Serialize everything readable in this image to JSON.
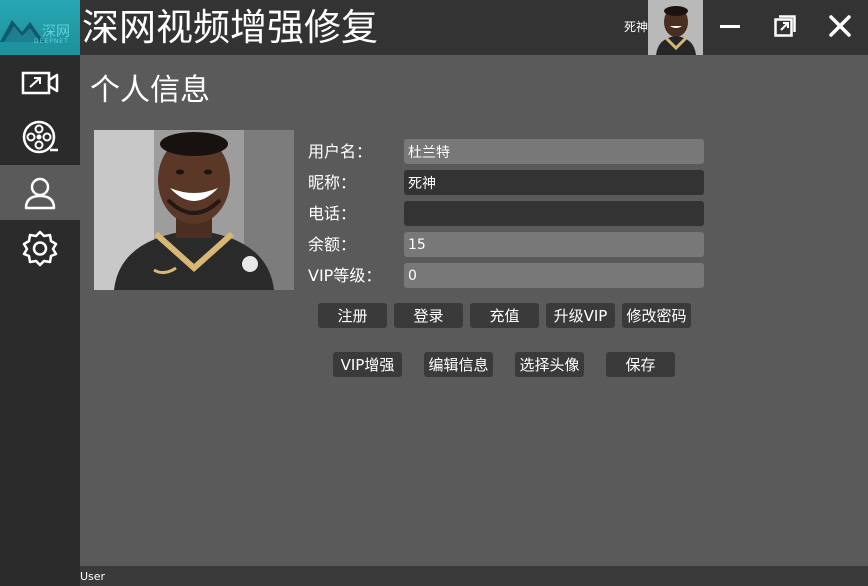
{
  "app": {
    "title": "深网视频增强修复",
    "logo_text": "DEEPNET"
  },
  "header": {
    "username": "死神",
    "avatar_icon": "user-avatar-photo",
    "controls": [
      "minimize-icon",
      "restore-icon",
      "close-icon"
    ]
  },
  "sidebar": {
    "items": [
      {
        "icon": "video-enhance-icon",
        "active": false
      },
      {
        "icon": "film-reel-icon",
        "active": false
      },
      {
        "icon": "user-icon",
        "active": true
      },
      {
        "icon": "gear-icon",
        "active": false
      }
    ]
  },
  "main": {
    "page_title": "个人信息",
    "fields": [
      {
        "label": "用户名：",
        "value": "杜兰特",
        "style": "light"
      },
      {
        "label": "昵称：",
        "value": "死神",
        "style": "dark"
      },
      {
        "label": "电话：",
        "value": "",
        "style": "dark"
      },
      {
        "label": "余额：",
        "value": "15",
        "style": "light"
      },
      {
        "label": "VIP等级：",
        "value": "0",
        "style": "light"
      }
    ],
    "buttons_row1": [
      "注册",
      "登录",
      "充值",
      "升级VIP",
      "修改密码"
    ],
    "buttons_row2": [
      "VIP增强",
      "编辑信息",
      "选择头像",
      "保存"
    ]
  },
  "status": {
    "text": "User"
  },
  "colors": {
    "background": "#5a5a5a",
    "topbar": "#333333",
    "sidebar": "#2b2b2b",
    "logo": "#27a7b3",
    "input_light": "#787878",
    "input_dark": "#333333",
    "button": "#3a3a3a",
    "text": "#ffffff"
  }
}
